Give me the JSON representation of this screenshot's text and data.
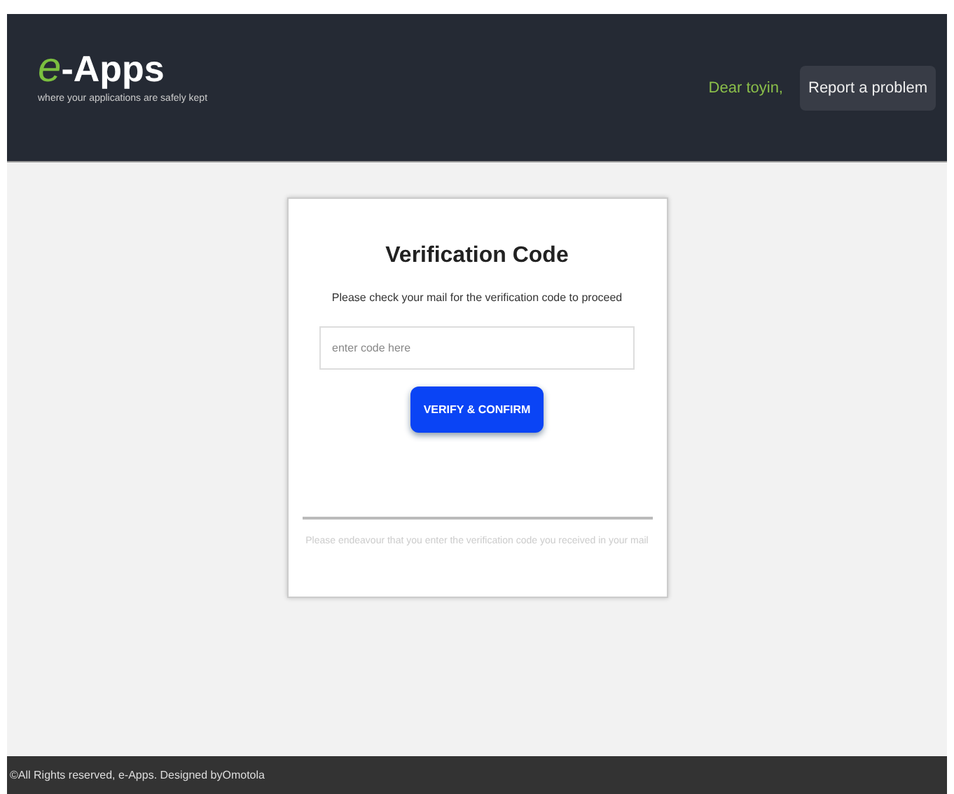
{
  "header": {
    "logo": {
      "letter": "e",
      "name": "-Apps"
    },
    "tagline": "where your applications are safely kept",
    "greeting": "Dear toyin,",
    "report_button": "Report a problem"
  },
  "card": {
    "title": "Verification Code",
    "instruction": "Please check your mail for the verification code to proceed",
    "code_field": {
      "placeholder": "enter code here"
    },
    "submit_button": "VERIFY & CONFIRM",
    "note": "Please endeavour that you enter the verification code you received in your mail"
  },
  "footer": {
    "text": "©All Rights reserved, e-Apps. Designed byOmotola"
  }
}
